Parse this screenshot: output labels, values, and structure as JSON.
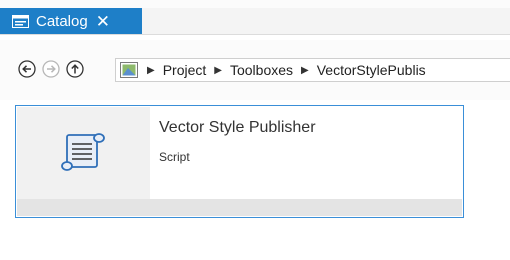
{
  "tab": {
    "title": "Catalog",
    "close_icon": "✕",
    "icon": "catalog-icon"
  },
  "nav": {
    "back_icon": "back-arrow-icon",
    "forward_icon": "forward-arrow-icon",
    "up_icon": "up-arrow-icon",
    "breadcrumb": [
      {
        "label": "Project"
      },
      {
        "label": "Toolboxes"
      },
      {
        "label": "VectorStylePublis"
      }
    ]
  },
  "item": {
    "title": "Vector Style Publisher",
    "type": "Script",
    "icon": "script-scroll-icon"
  },
  "colors": {
    "tab_blue": "#1e7fc8",
    "selection_border": "#3a8fd8"
  }
}
